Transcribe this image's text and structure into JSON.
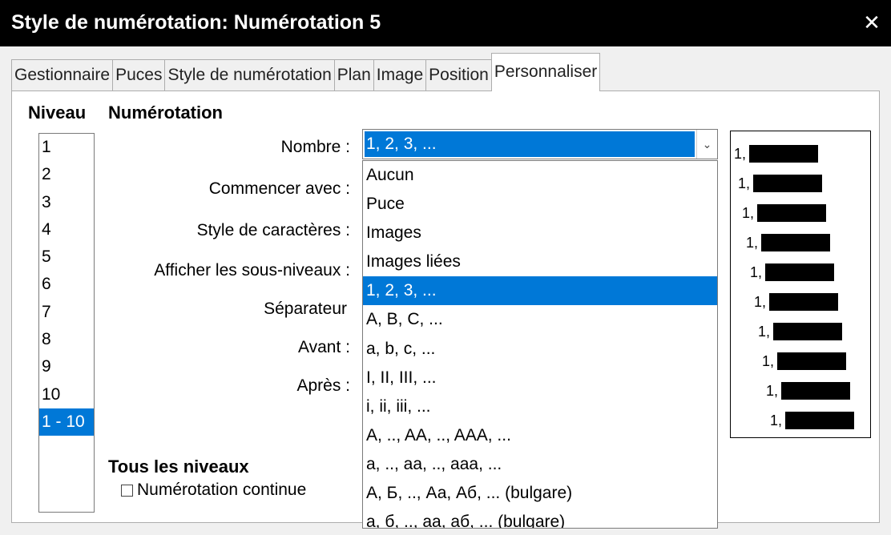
{
  "window": {
    "title": "Style de numérotation: Numérotation 5",
    "close_glyph": "✕"
  },
  "tabs": [
    {
      "label": "Gestionnaire"
    },
    {
      "label": "Puces"
    },
    {
      "label": "Style de numérotation"
    },
    {
      "label": "Plan"
    },
    {
      "label": "Image"
    },
    {
      "label": "Position"
    },
    {
      "label": "Personnaliser",
      "active": true
    }
  ],
  "levels": {
    "heading": "Niveau",
    "items": [
      "1",
      "2",
      "3",
      "4",
      "5",
      "6",
      "7",
      "8",
      "9",
      "10",
      "1 - 10"
    ],
    "selected": "1 - 10"
  },
  "numbering": {
    "heading": "Numérotation",
    "number_label": "Nombre :",
    "start_label": "Commencer avec :",
    "char_style_label": "Style de caractères :",
    "sublevels_label": "Afficher les sous-niveaux :",
    "separator_label": "Séparateur",
    "before_label": "Avant :",
    "after_label": "Après :",
    "number_value": "1, 2, 3, ...",
    "dropdown_arrow": "⌄",
    "options": [
      "Aucun",
      "Puce",
      "Images",
      "Images liées",
      "1, 2, 3, ...",
      "A, B, C, ...",
      "a, b, c, ...",
      "I, II, III, ...",
      "i, ii, iii, ...",
      "A, .., AA, .., AAA, ...",
      "a, .., aa, .., aaa, ...",
      "А, Б, .., Аа, Аб, ... (bulgare)",
      "а, б, .., аа, аб, ... (bulgare)"
    ],
    "selected_option": "1, 2, 3, ..."
  },
  "all_levels": {
    "heading": "Tous les niveaux",
    "continuous_label": "Numérotation continue",
    "continuous_checked": false
  },
  "preview": {
    "lines": [
      "1,",
      "1,",
      "1,",
      "1,",
      "1,",
      "1,",
      "1,",
      "1,",
      "1,",
      "1,"
    ]
  },
  "colors": {
    "selection": "#0078d7",
    "titlebar": "#000000"
  }
}
